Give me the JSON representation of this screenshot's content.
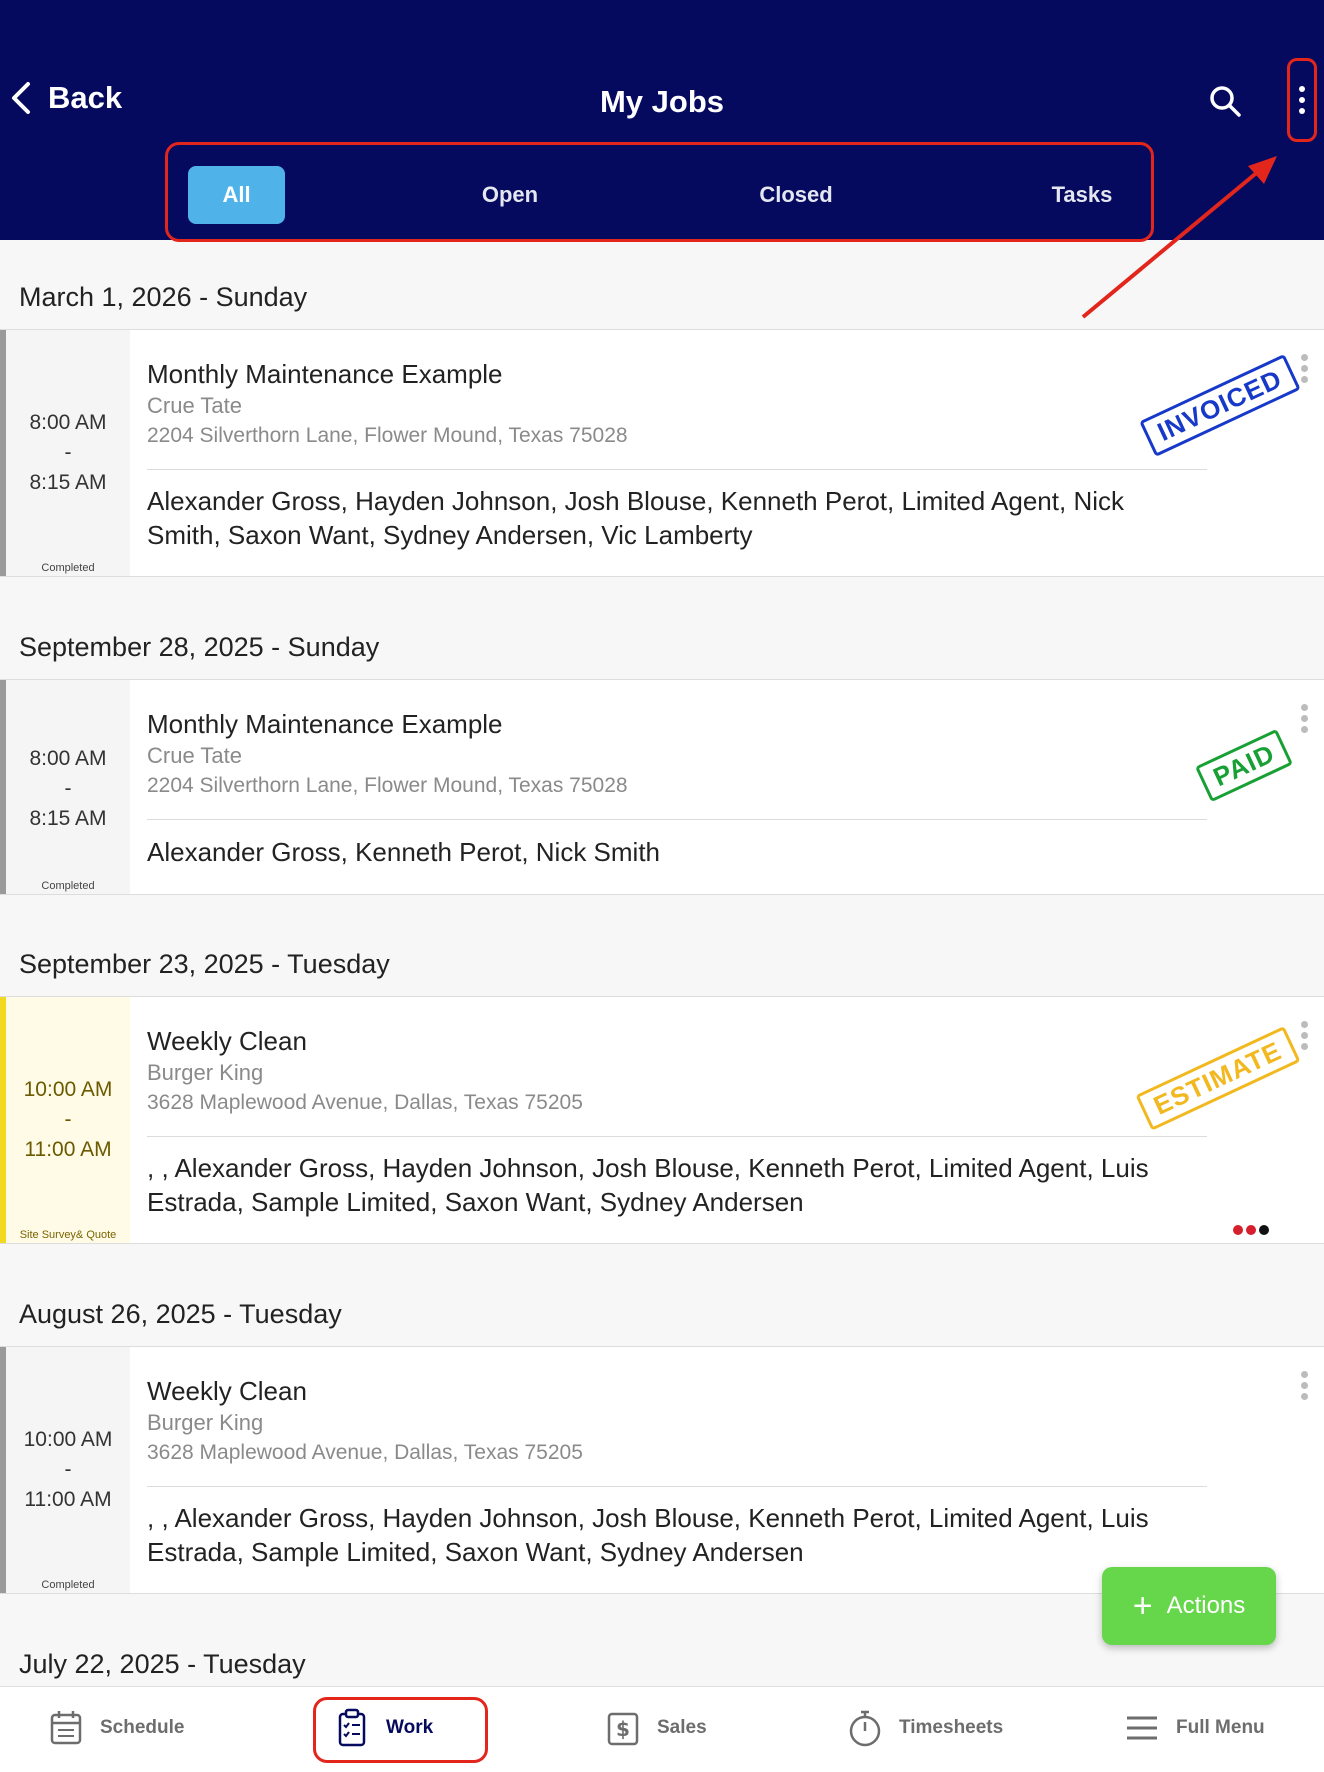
{
  "header": {
    "back_label": "Back",
    "title": "My Jobs",
    "tabs": [
      {
        "label": "All",
        "active": true
      },
      {
        "label": "Open",
        "active": false
      },
      {
        "label": "Closed",
        "active": false
      },
      {
        "label": "Tasks",
        "active": false
      }
    ]
  },
  "jobs": [
    {
      "date": "March 1, 2026 - Sunday",
      "start": "8:00 AM",
      "sep": "-",
      "end": "8:15 AM",
      "status": "Completed",
      "title": "Monthly Maintenance Example",
      "customer": "Crue Tate",
      "address": "2204 Silverthorn Lane, Flower Mound, Texas 75028",
      "crew": "Alexander Gross, Hayden Johnson, Josh Blouse, Kenneth Perot, Limited Agent, Nick Smith, Saxon Want, Sydney Andersen, Vic Lamberty",
      "stamp": "INVOICED"
    },
    {
      "date": "September 28, 2025 - Sunday",
      "start": "8:00 AM",
      "sep": "-",
      "end": "8:15 AM",
      "status": "Completed",
      "title": "Monthly Maintenance Example",
      "customer": "Crue Tate",
      "address": "2204 Silverthorn Lane, Flower Mound, Texas 75028",
      "crew": "Alexander Gross, Kenneth Perot, Nick Smith",
      "stamp": "PAID"
    },
    {
      "date": "September 23, 2025 - Tuesday",
      "start": "10:00 AM",
      "sep": "-",
      "end": "11:00 AM",
      "status": "Site Survey& Quote",
      "title": "Weekly Clean",
      "customer": "Burger King",
      "address": "3628 Maplewood Avenue, Dallas, Texas 75205",
      "crew": ", , Alexander Gross, Hayden Johnson, Josh Blouse, Kenneth Perot, Limited Agent, Luis Estrada, Sample Limited, Saxon Want, Sydney Andersen",
      "stamp": "ESTIMATE",
      "status_dot_colors": [
        "#d61f2c",
        "#d61f2c",
        "#111111"
      ]
    },
    {
      "date": "August 26, 2025 - Tuesday",
      "start": "10:00 AM",
      "sep": "-",
      "end": "11:00 AM",
      "status": "Completed",
      "title": "Weekly Clean",
      "customer": "Burger King",
      "address": "3628 Maplewood Avenue, Dallas, Texas 75205",
      "crew": ", , Alexander Gross, Hayden Johnson, Josh Blouse, Kenneth Perot, Limited Agent, Luis Estrada, Sample Limited, Saxon Want, Sydney Andersen"
    },
    {
      "date": "July 22, 2025 - Tuesday"
    }
  ],
  "fab": {
    "plus": "+",
    "label": "Actions"
  },
  "bottom_nav": [
    {
      "label": "Schedule",
      "icon": "calendar-icon"
    },
    {
      "label": "Work",
      "icon": "clipboard-icon",
      "active": true
    },
    {
      "label": "Sales",
      "icon": "dollar-icon"
    },
    {
      "label": "Timesheets",
      "icon": "stopwatch-icon"
    },
    {
      "label": "Full Menu",
      "icon": "hamburger-menu-icon"
    }
  ],
  "colors": {
    "header_bg": "#050a5e",
    "tab_active": "#4fb3ea",
    "highlight_red": "#e3261c",
    "fab_green": "#66d64b",
    "stamp_invoiced": "#1739c9",
    "stamp_paid": "#18a035",
    "stamp_estimate": "#f2b81f",
    "survey_yellow": "#f2d81f"
  }
}
